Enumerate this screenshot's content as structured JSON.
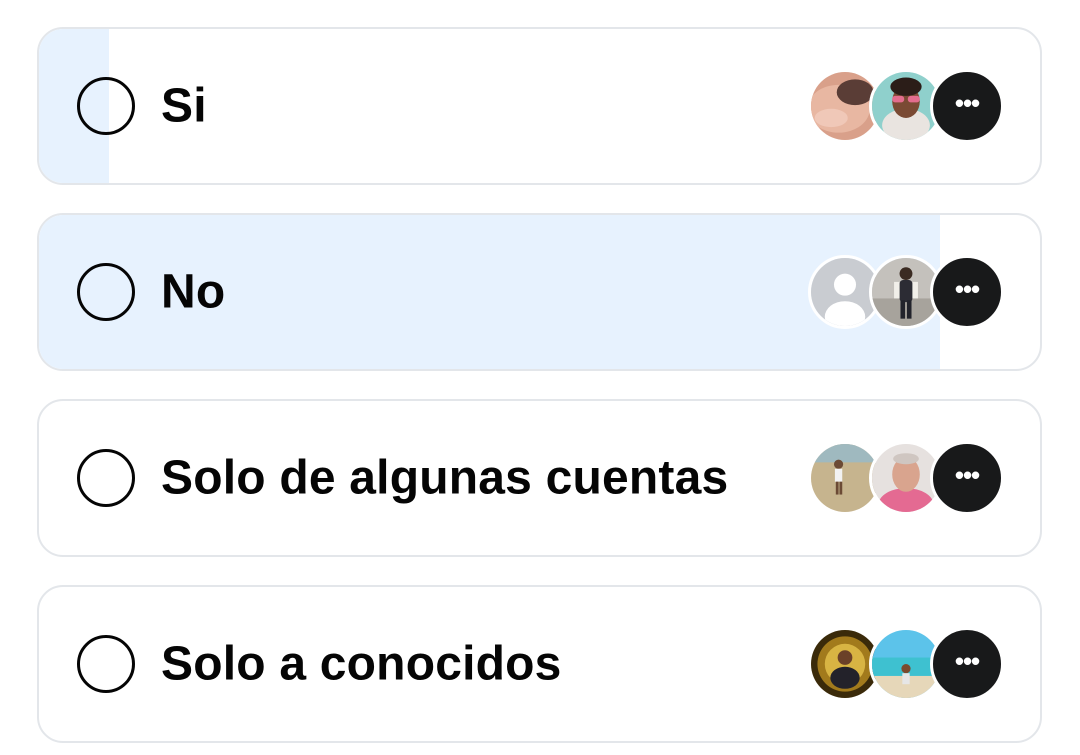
{
  "poll": {
    "options": [
      {
        "label": "Si",
        "vote_fraction": 0.07,
        "voters": [
          "voter-photo-skin-closeup",
          "voter-photo-woman-sunglasses",
          "more-voters"
        ]
      },
      {
        "label": "No",
        "vote_fraction": 0.9,
        "voters": [
          "default-avatar-placeholder",
          "voter-photo-person-standing",
          "more-voters"
        ]
      },
      {
        "label": "Solo de algunas cuentas",
        "vote_fraction": 0,
        "voters": [
          "voter-photo-beach-person",
          "voter-photo-man-pink-shirt",
          "more-voters"
        ]
      },
      {
        "label": "Solo a conocidos",
        "vote_fraction": 0,
        "voters": [
          "voter-photo-gold-flyer",
          "voter-photo-sea-person",
          "more-voters"
        ]
      }
    ],
    "more_glyph": "•••",
    "colors": {
      "fill": "#e7f2fe",
      "border": "#e3e6ea",
      "text": "#050505",
      "more_bg": "#18191a"
    }
  }
}
